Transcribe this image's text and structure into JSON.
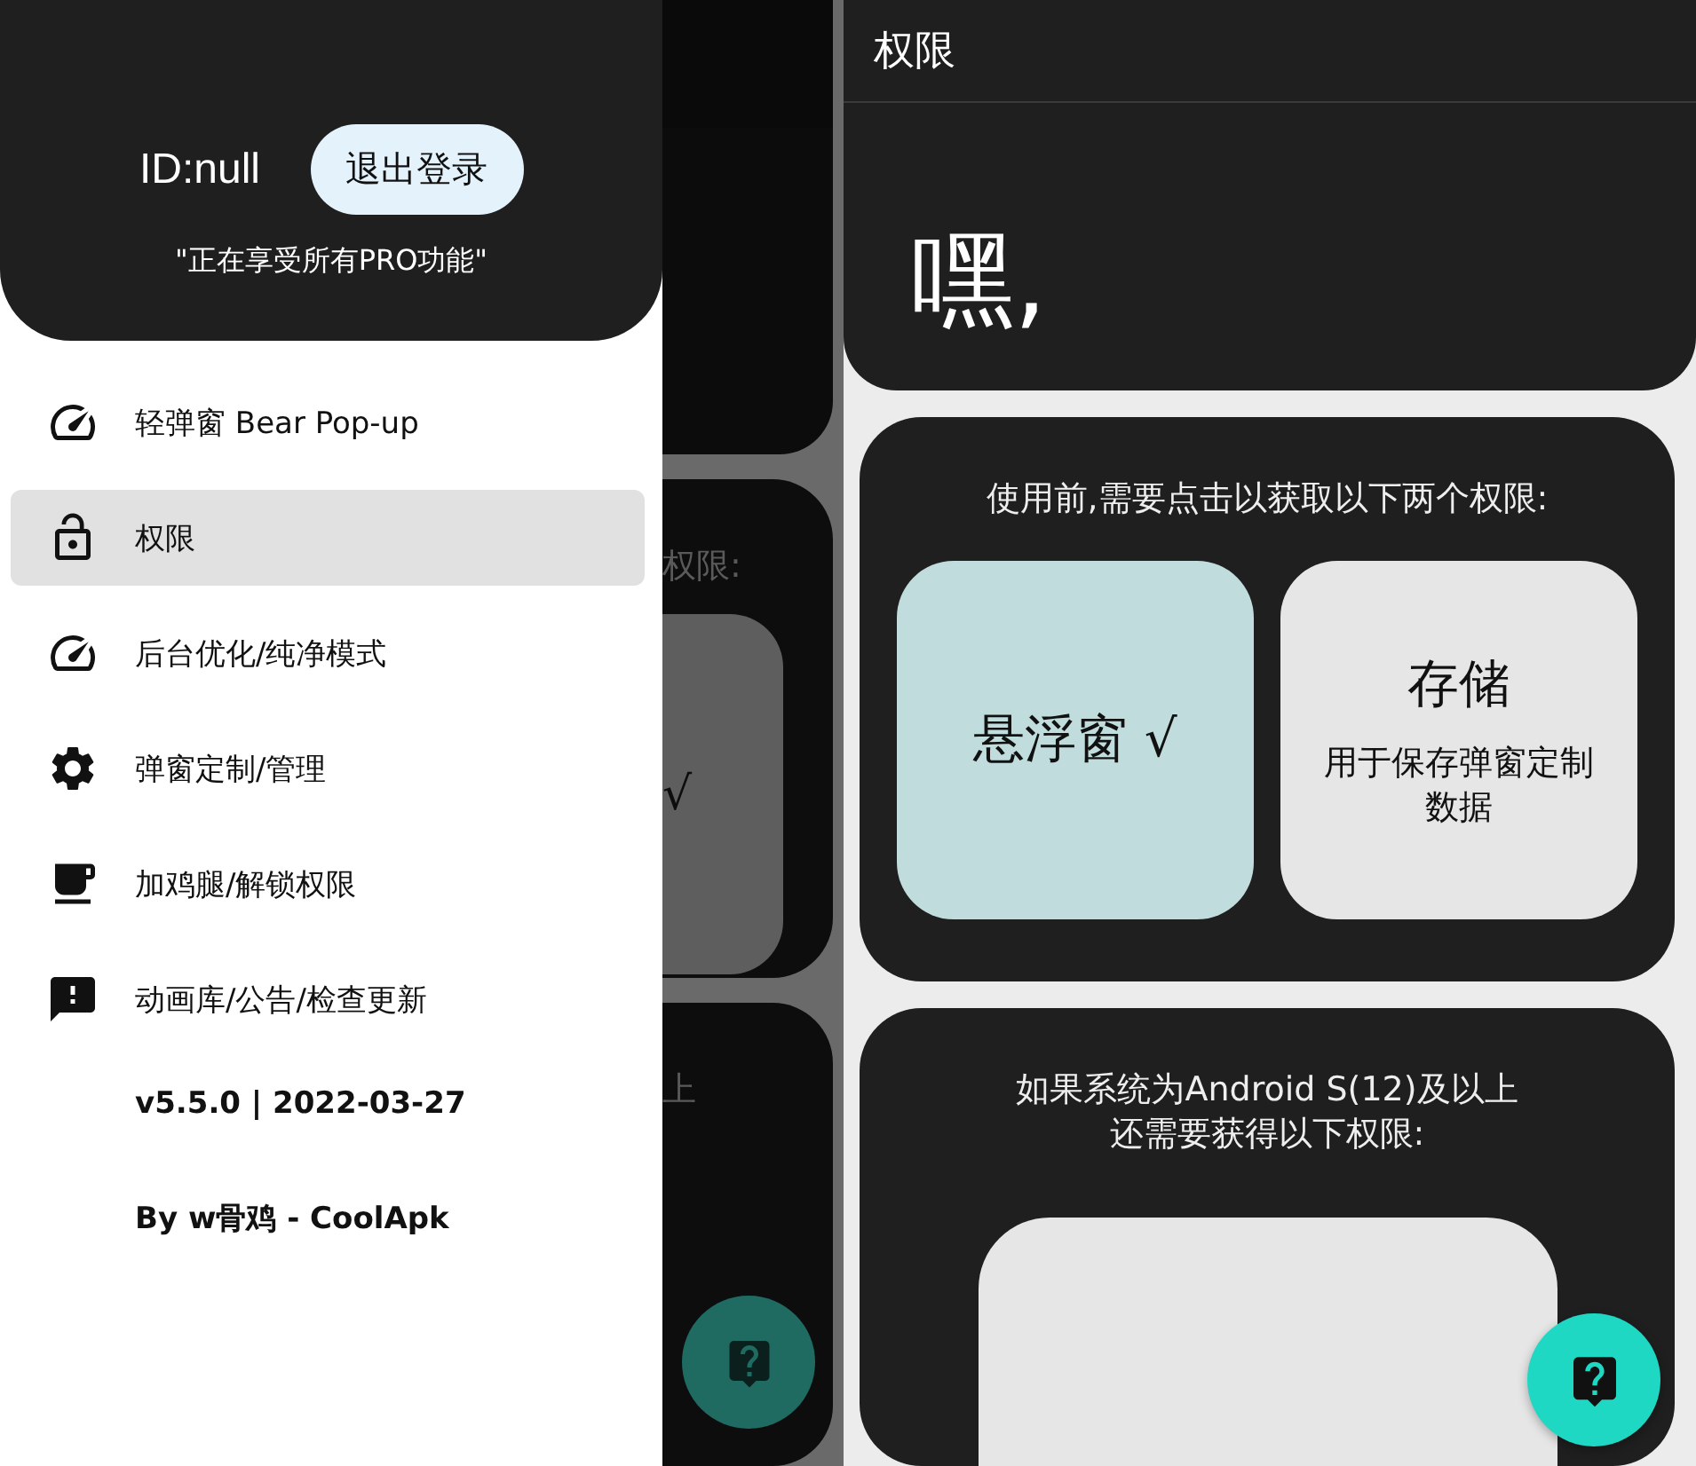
{
  "drawer": {
    "user_id": "ID:null",
    "logout_button": "退出登录",
    "status": "\"正在享受所有PRO功能\"",
    "items": [
      {
        "label": "轻弹窗 Bear Pop-up",
        "kind": "speed",
        "selected": false
      },
      {
        "label": "权限",
        "kind": "lock",
        "selected": true
      },
      {
        "label": "后台优化/纯净模式",
        "kind": "speed",
        "selected": false
      },
      {
        "label": "弹窗定制/管理",
        "kind": "settings",
        "selected": false
      },
      {
        "label": "加鸡腿/解锁权限",
        "kind": "cup",
        "selected": false
      },
      {
        "label": "动画库/公告/检查更新",
        "kind": "feedback",
        "selected": false
      }
    ],
    "footer": [
      "v5.5.0 | 2022-03-27",
      "By w骨鸡 - CoolApk"
    ]
  },
  "background_app": {
    "texts": [
      "权限:",
      "√",
      "上"
    ]
  },
  "screen": {
    "title": "权限",
    "greeting": "嘿,",
    "permissions_card": {
      "prompt": "使用前,需要点击以获取以下两个权限:",
      "tiles": [
        {
          "title": "悬浮窗 √",
          "granted": true
        },
        {
          "title": "存储",
          "description": "用于保存弹窗定制数据",
          "granted": false
        }
      ]
    },
    "android12_card": {
      "prompt": [
        "如果系统为Android S(12)及以上",
        "还需要获得以下权限:"
      ]
    }
  }
}
